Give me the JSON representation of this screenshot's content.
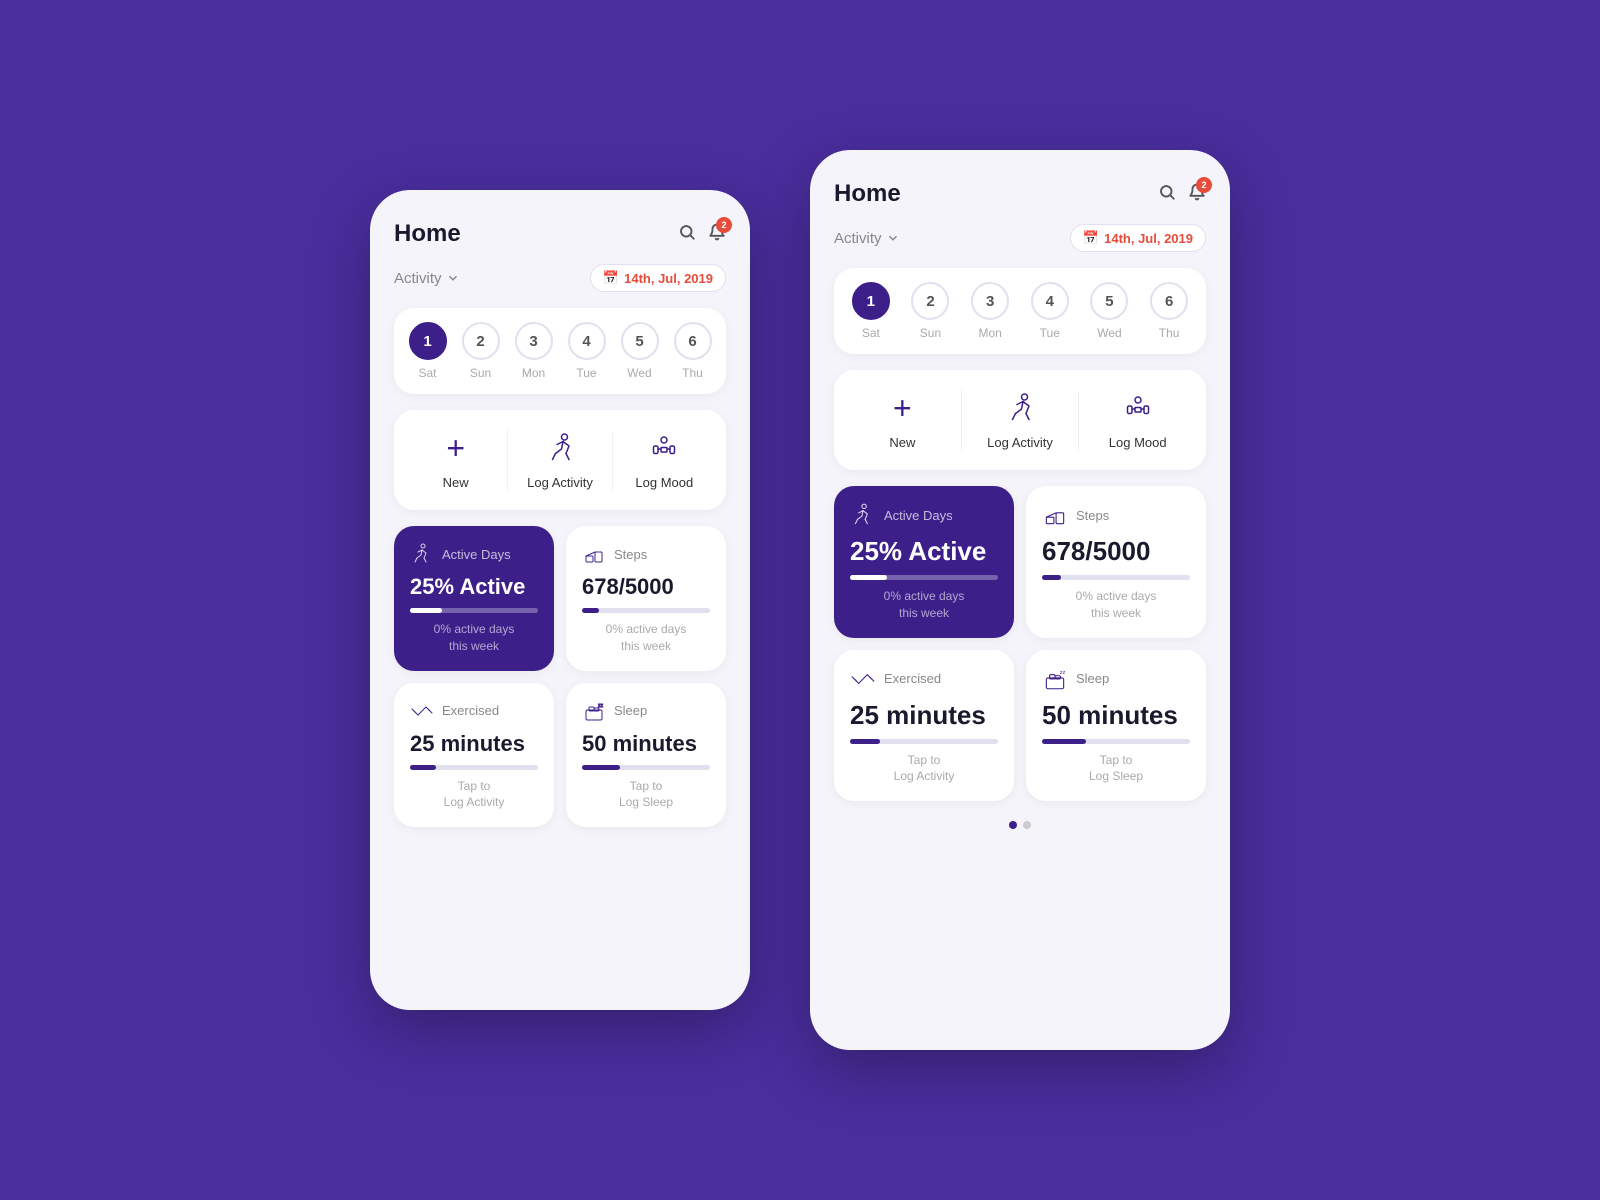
{
  "app": {
    "title": "Home",
    "notification_count": "2",
    "activity_label": "Activity",
    "date_label": "14th, Jul, 2019"
  },
  "calendar": {
    "days": [
      {
        "num": "1",
        "label": "Sat",
        "active": true
      },
      {
        "num": "2",
        "label": "Sun",
        "active": false
      },
      {
        "num": "3",
        "label": "Mon",
        "active": false
      },
      {
        "num": "4",
        "label": "Tue",
        "active": false
      },
      {
        "num": "5",
        "label": "Wed",
        "active": false
      },
      {
        "num": "6",
        "label": "Thu",
        "active": false
      }
    ]
  },
  "actions": [
    {
      "label": "New",
      "icon": "+"
    },
    {
      "label": "Log Activity",
      "icon": "run"
    },
    {
      "label": "Log Mood",
      "icon": "lift"
    }
  ],
  "stats": [
    {
      "title": "Active Days",
      "value": "25% Active",
      "progress": 25,
      "sub": "0% active days\nthis week",
      "dark": true
    },
    {
      "title": "Steps",
      "value": "678/5000",
      "progress": 13,
      "sub": "0% active days\nthis week",
      "dark": false
    },
    {
      "title": "Exercised",
      "value": "25 minutes",
      "progress": 20,
      "sub": "Tap to\nLog Activity",
      "dark": false
    },
    {
      "title": "Sleep",
      "value": "50 minutes",
      "progress": 30,
      "sub": "Tap to\nLog Sleep",
      "dark": false
    }
  ],
  "dots": [
    true,
    false
  ]
}
